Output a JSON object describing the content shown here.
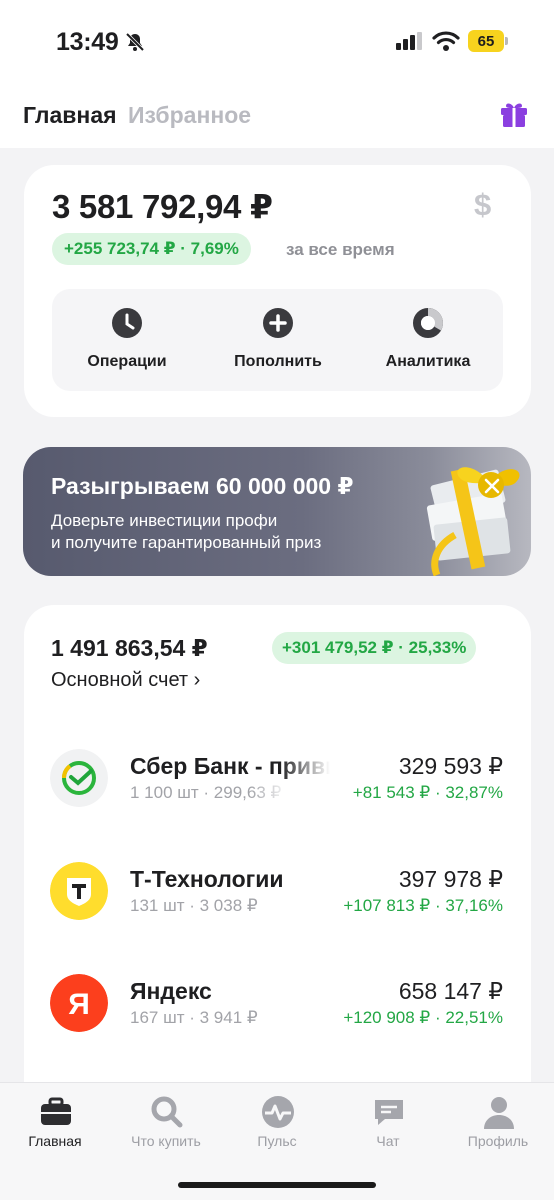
{
  "status": {
    "time": "13:49",
    "battery": "65",
    "colors": {
      "battery": "#f7d31e"
    }
  },
  "topnav": {
    "tabs": [
      {
        "label": "Главная",
        "active": true
      },
      {
        "label": "Избранное",
        "active": false
      }
    ],
    "gift_icon": "gift-icon",
    "colors": {
      "gift": "#8b3fe0"
    }
  },
  "portfolio": {
    "total": "3 581 792,94 ₽",
    "currency_toggle": "$",
    "change": "+255 723,74 ₽ · 7,69%",
    "period": "за все время",
    "actions": [
      {
        "label": "Операции",
        "icon": "clock-icon"
      },
      {
        "label": "Пополнить",
        "icon": "plus-icon"
      },
      {
        "label": "Аналитика",
        "icon": "donut-chart-icon"
      }
    ]
  },
  "banner": {
    "title": "Разыгрываем 60 000 000 ₽",
    "line1": "Доверьте инвестиции профи",
    "line2": "и получите гарантированный приз",
    "close_icon": "close-icon"
  },
  "account": {
    "total": "1 491 863,54 ₽",
    "change": "+301 479,52 ₽ · 25,33%",
    "name": "Основной счет ›",
    "holdings": [
      {
        "name": "Сбер Банк - привилегированные акции",
        "details": "1 100 шт · 299,63 ₽",
        "value": "329 593 ₽",
        "change": "+81 543 ₽ · 32,87%",
        "logo": "sber-logo-icon"
      },
      {
        "name": "Т-Технологии",
        "details": "131 шт · 3 038 ₽",
        "value": "397 978 ₽",
        "change": "+107 813 ₽ · 37,16%",
        "logo": "t-tech-logo-icon"
      },
      {
        "name": "Яндекс",
        "details": "167 шт · 3 941 ₽",
        "value": "658 147 ₽",
        "change": "+120 908 ₽ · 22,51%",
        "logo": "yandex-logo-icon"
      }
    ]
  },
  "tabbar": {
    "items": [
      {
        "label": "Главная",
        "icon": "briefcase-icon",
        "active": true
      },
      {
        "label": "Что купить",
        "icon": "search-icon",
        "active": false
      },
      {
        "label": "Пульс",
        "icon": "pulse-icon",
        "active": false
      },
      {
        "label": "Чат",
        "icon": "chat-icon",
        "active": false
      },
      {
        "label": "Профиль",
        "icon": "profile-icon",
        "active": false
      }
    ]
  },
  "colors": {
    "positive": "#23a745",
    "positive_bg": "#dcf5e1",
    "muted": "#a2a3a8",
    "background": "#f3f3f5"
  }
}
